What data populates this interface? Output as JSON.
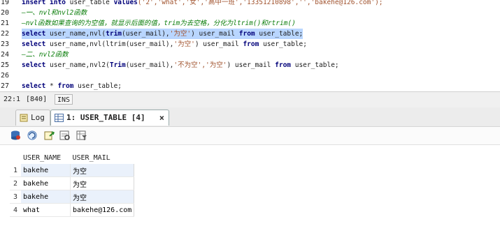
{
  "editor": {
    "lines": [
      {
        "n": "19",
        "parts": [
          {
            "t": "insert into ",
            "k": "kw"
          },
          {
            "t": "user_table ",
            "k": ""
          },
          {
            "t": "values",
            "k": "kw"
          },
          {
            "t": "('2','what','女','高中一班','13351210898','','bakehe@126.com');",
            "k": "str"
          }
        ]
      },
      {
        "n": "20",
        "parts": [
          {
            "t": "—一、nvl和nvl2函数",
            "k": "cm"
          }
        ]
      },
      {
        "n": "21",
        "parts": [
          {
            "t": "—nvl函数如果查询的为空值，就显示后面的值，trim为去空格，分化为ltrim()和rtrim()",
            "k": "cm"
          }
        ]
      },
      {
        "n": "22",
        "selected": true,
        "parts": [
          {
            "t": "select ",
            "k": "kw"
          },
          {
            "t": "user_name,nvl(",
            "k": ""
          },
          {
            "t": "trim",
            "k": "kw"
          },
          {
            "t": "(user_mail),",
            "k": ""
          },
          {
            "t": "'为空'",
            "k": "str"
          },
          {
            "t": ") user_mail ",
            "k": ""
          },
          {
            "t": "from ",
            "k": "kw"
          },
          {
            "t": "user_table;",
            "k": ""
          }
        ]
      },
      {
        "n": "23",
        "parts": [
          {
            "t": "select ",
            "k": "kw"
          },
          {
            "t": "user_name,nvl(ltrim(user_mail),",
            "k": ""
          },
          {
            "t": "'为空'",
            "k": "str"
          },
          {
            "t": ") user_mail ",
            "k": ""
          },
          {
            "t": "from ",
            "k": "kw"
          },
          {
            "t": "user_table;",
            "k": ""
          }
        ]
      },
      {
        "n": "24",
        "parts": [
          {
            "t": "—二、nvl2函数",
            "k": "cm"
          }
        ]
      },
      {
        "n": "25",
        "parts": [
          {
            "t": "select ",
            "k": "kw"
          },
          {
            "t": "user_name,nvl2(",
            "k": ""
          },
          {
            "t": "Trim",
            "k": "kw"
          },
          {
            "t": "(user_mail),",
            "k": ""
          },
          {
            "t": "'不为空','为空'",
            "k": "str"
          },
          {
            "t": ") user_mail ",
            "k": ""
          },
          {
            "t": "from ",
            "k": "kw"
          },
          {
            "t": "user_table;",
            "k": ""
          }
        ]
      },
      {
        "n": "26",
        "parts": []
      },
      {
        "n": "27",
        "parts": [
          {
            "t": "select ",
            "k": "kw"
          },
          {
            "t": "* ",
            "k": ""
          },
          {
            "t": "from ",
            "k": "kw"
          },
          {
            "t": "user_table;",
            "k": ""
          }
        ]
      }
    ]
  },
  "status": {
    "position": "22:1",
    "chars": "[840]",
    "mode": "INS"
  },
  "tabs": {
    "log": "Log",
    "result": "1: USER_TABLE [4]",
    "close": "×"
  },
  "toolbar": {
    "icons": [
      "database-icon",
      "refresh-icon",
      "export-icon",
      "query-icon",
      "filter-icon"
    ]
  },
  "grid": {
    "columns": [
      "USER_NAME",
      "USER_MAIL"
    ],
    "rows": [
      {
        "n": "1",
        "name": "bakehe",
        "mail": "为空"
      },
      {
        "n": "2",
        "name": "bakehe",
        "mail": "为空"
      },
      {
        "n": "3",
        "name": "bakehe",
        "mail": "为空"
      },
      {
        "n": "4",
        "name": "what",
        "mail": "bakehe@126.com"
      }
    ]
  },
  "colors": {
    "selection": "#b9d6ff",
    "keyword": "#00007a",
    "string": "#a0522d",
    "comment": "#0a7d0a"
  }
}
